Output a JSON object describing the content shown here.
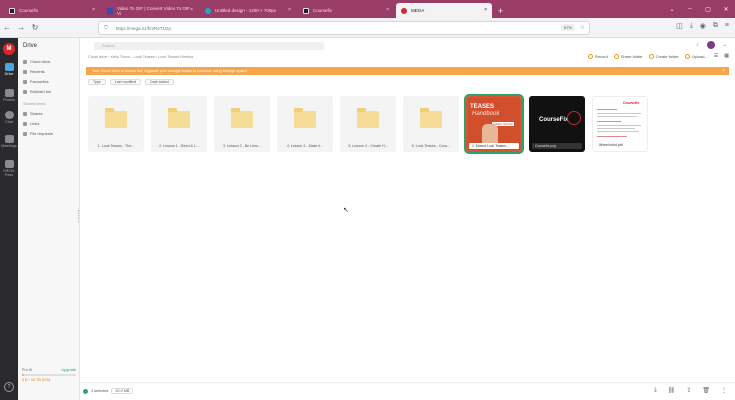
{
  "browser": {
    "tabs": [
      {
        "label": "Coursefix",
        "favicon_color": "#222222",
        "active": false
      },
      {
        "label": "Video To GIF | Convert Video To GIF Vi",
        "favicon_color": "#2f4dbb",
        "active": false
      },
      {
        "label": "Untitled design - 1200 × 700px",
        "favicon_color": "#1fa7c7",
        "active": false
      },
      {
        "label": "Coursefix",
        "favicon_color": "#222222",
        "active": false
      },
      {
        "label": "MEGA",
        "favicon_color": "#d9272e",
        "active": true
      }
    ],
    "close_glyph": "×",
    "new_tab_glyph": "+",
    "url": "https://mega.nz/fm/ReT1Gp",
    "zoom": "67%"
  },
  "rail": {
    "logo": "M",
    "items": [
      {
        "label": "Drive",
        "selected": true
      },
      {
        "label": "Photos",
        "selected": false
      },
      {
        "label": "Chat",
        "selected": false
      },
      {
        "label": "Meetings",
        "selected": false
      },
      {
        "label": "MEGA Pass",
        "selected": false
      }
    ],
    "help": "?"
  },
  "sidebar": {
    "title": "Drive",
    "items": [
      "Cloud drive",
      "Recents",
      "Favourites",
      "Rubbish bin"
    ],
    "shared_heading": "Shared items",
    "shared_items": [
      "Shares",
      "Links",
      "File requests"
    ],
    "storage": {
      "plan": "Pro III",
      "upgrade": "Upgrade",
      "used": "0 B / 16 TB (0%)",
      "fill_fraction": 0.04
    }
  },
  "main": {
    "search_placeholder": "Search",
    "breadcrumb": "Cloud drive  ›  Kelly Tfouw - Look Teases  ›  Look Teases Method",
    "actions": [
      "Record",
      "Share folder",
      "Create folder",
      "Upload..."
    ],
    "banner": "Your Cloud drive is almost full. Upgrade your storage space to continue using storage space.",
    "filters": [
      "Type",
      "Last modified",
      "Date added"
    ],
    "folders": [
      "1. Look Teases - The...",
      "2. Lesson 1 - Reed & L...",
      "3. Lesson 2 - Be Unru...",
      "4. Lesson 3 - Make it...",
      "5. Lesson 4 - Create H...",
      "6. Look Teases - Conc..."
    ],
    "files": [
      {
        "caption": "1. Moved Look Teases...",
        "thumb_title": "TEASES",
        "thumb_sub": "Handbook",
        "thumb_tag": "VIDEO SHOW",
        "selected": true
      },
      {
        "caption": "Coursefix.png",
        "thumb_title": "CourseFix",
        "selected": false
      },
      {
        "caption": "Wheel mind.pdf",
        "thumb_title": "Coursefix",
        "selected": false
      }
    ],
    "status": {
      "selected": "1 selected",
      "size": "20.0 MB"
    }
  }
}
